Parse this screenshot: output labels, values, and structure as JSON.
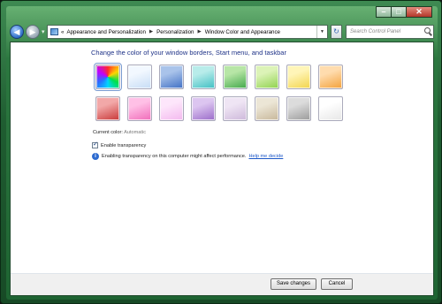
{
  "window": {
    "caption_buttons": [
      "minimize",
      "maximize",
      "close"
    ]
  },
  "toolbar": {
    "back_icon": "back-arrow-icon",
    "forward_icon": "forward-arrow-icon",
    "history_icon": "chevron-down-icon",
    "breadcrumb": [
      {
        "label": "Appearance and Personalization"
      },
      {
        "label": "Personalization"
      },
      {
        "label": "Window Color and Appearance"
      }
    ],
    "breadcrumb_root_glyph": "«",
    "search_placeholder": "Search Control Panel"
  },
  "main": {
    "title": "Change the color of your window borders, Start menu, and taskbar",
    "swatches": [
      {
        "name": "automatic",
        "colors": [
          "#ff2a2a",
          "#00ff66",
          "#2b6bff"
        ],
        "selected": true
      },
      {
        "name": "sky",
        "colors": [
          "#f2f8ff",
          "#c6dcf5"
        ],
        "selected": false
      },
      {
        "name": "twilight",
        "colors": [
          "#a9c3ea",
          "#3f6fc4"
        ],
        "selected": false
      },
      {
        "name": "sea",
        "colors": [
          "#b8ecea",
          "#3fbfc3"
        ],
        "selected": false
      },
      {
        "name": "leaf",
        "colors": [
          "#b7e6a6",
          "#41a84a"
        ],
        "selected": false
      },
      {
        "name": "lime",
        "colors": [
          "#dcf3b7",
          "#8fd24d"
        ],
        "selected": false
      },
      {
        "name": "sun",
        "colors": [
          "#fff5b8",
          "#f2d44a"
        ],
        "selected": false
      },
      {
        "name": "pumpkin",
        "colors": [
          "#ffdcae",
          "#f3a13a"
        ],
        "selected": false
      },
      {
        "name": "ruby",
        "colors": [
          "#f2a8a8",
          "#c83737"
        ],
        "selected": false
      },
      {
        "name": "fuchsia",
        "colors": [
          "#ffc0e6",
          "#f06bb9"
        ],
        "selected": false
      },
      {
        "name": "blush",
        "colors": [
          "#fde6fb",
          "#f3b8ee"
        ],
        "selected": false
      },
      {
        "name": "violet",
        "colors": [
          "#dcc5f0",
          "#9a6bc9"
        ],
        "selected": false
      },
      {
        "name": "lavender",
        "colors": [
          "#efe5f4",
          "#cdb8da"
        ],
        "selected": false
      },
      {
        "name": "taupe",
        "colors": [
          "#ece6d6",
          "#c7b79a"
        ],
        "selected": false
      },
      {
        "name": "chocolate",
        "colors": [
          "#dcdcdc",
          "#9a9a9a"
        ],
        "selected": false
      },
      {
        "name": "frost",
        "colors": [
          "#ffffff",
          "#e6e6e6"
        ],
        "selected": false
      }
    ],
    "current_color_label": "Current color:",
    "current_color_value": "Automatic",
    "transparency_label": "Enable transparency",
    "transparency_checked": true,
    "info_icon": "info-icon",
    "info_text": "Enabling transparency on this computer might affect performance.",
    "help_link": "Help me decide"
  },
  "footer": {
    "save_label": "Save changes",
    "cancel_label": "Cancel"
  }
}
